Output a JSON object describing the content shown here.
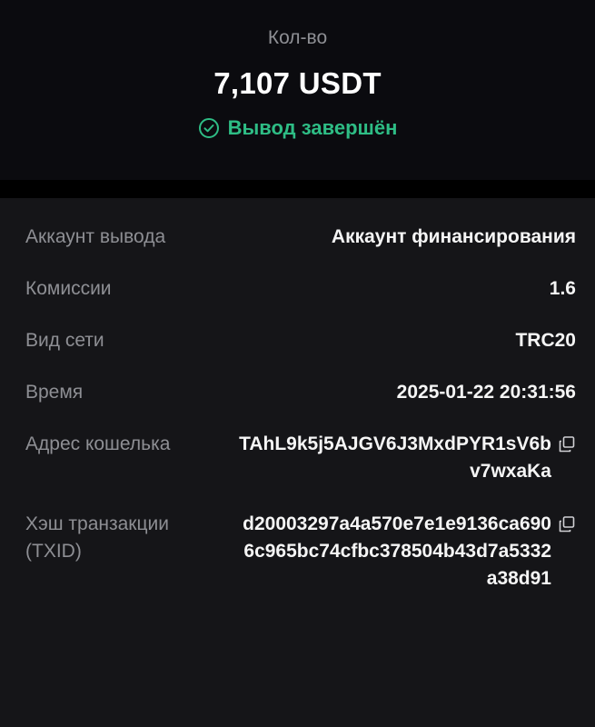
{
  "header": {
    "amount_label": "Кол-во",
    "amount_value": "7,107 USDT",
    "status_text": "Вывод завершён",
    "status_icon": "check-circle-icon",
    "status_color": "#2ebd85"
  },
  "details": {
    "account": {
      "label": "Аккаунт вывода",
      "value": "Аккаунт финансирования"
    },
    "fee": {
      "label": "Комиссии",
      "value": "1.6"
    },
    "network": {
      "label": "Вид сети",
      "value": "TRC20"
    },
    "time": {
      "label": "Время",
      "value": "2025-01-22 20:31:56"
    },
    "address": {
      "label": "Адрес кошелька",
      "value": "TAhL9k5j5AJGV6J3MxdPYR1sV6bv7wxaKa",
      "copy_icon": "copy-icon"
    },
    "txid": {
      "label": "Хэш транзакции (TXID)",
      "value": "d20003297a4a570e7e1e9136ca6906c965bc74cfbc378504b43d7a5332a38d91",
      "copy_icon": "copy-icon"
    }
  },
  "colors": {
    "background": "#0b0b0f",
    "panel": "#151518",
    "label": "#8e8f94",
    "value": "#f5f5f5",
    "success": "#2ebd85"
  }
}
